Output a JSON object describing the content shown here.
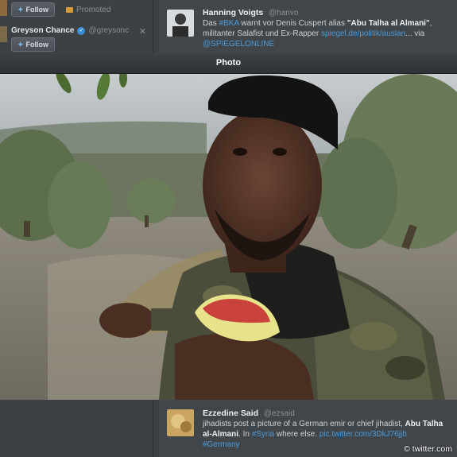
{
  "left_column": {
    "follow_label": "Follow",
    "promoted_label": "Promoted",
    "suggestion": {
      "name": "Greyson Chance",
      "handle": "@greysonc",
      "follow_label": "Follow"
    }
  },
  "tweets": [
    {
      "name": "Hanning Voigts",
      "handle": "@hanvo",
      "text_parts": {
        "p1": "Das ",
        "hashtag": "#BKA",
        "p2": " warnt vor Denis Cuspert alias ",
        "bold": "\"Abu Talha al Almani\"",
        "p3": ", militanter Salafist und Ex-Rapper ",
        "link": "spiegel.de/politik/auslan",
        "p4": "... via ",
        "mention": "@SPIEGELONLINE"
      }
    },
    {
      "name": "Ezzedine Said",
      "handle": "@ezsaid",
      "text_parts": {
        "p1": "jihadists post a picture of a German emir or chief jihadist, ",
        "bold": "Abu Talha al-Almani",
        "p2": ". In ",
        "hashtag": "#Syria",
        "p3": " where else. ",
        "link": "pic.twitter.com/3DkJ76jjb",
        "hashtag2": "#Germany"
      }
    }
  ],
  "photo_viewer": {
    "title": "Photo"
  },
  "watermark": "© twitter.com",
  "colors": {
    "accent_link": "#4b9ad8",
    "verified_badge": "#3a8ed8"
  }
}
